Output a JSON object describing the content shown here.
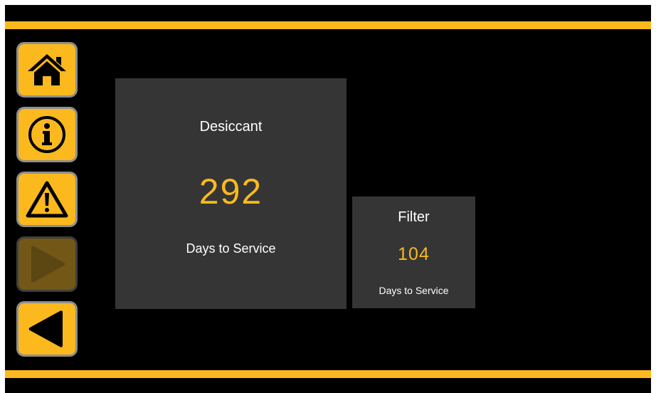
{
  "nav": {
    "buttons": [
      {
        "icon": "home-icon",
        "enabled": true
      },
      {
        "icon": "info-icon",
        "enabled": true
      },
      {
        "icon": "warning-icon",
        "enabled": true
      },
      {
        "icon": "play-right-icon",
        "enabled": false
      },
      {
        "icon": "back-left-icon",
        "enabled": true
      }
    ]
  },
  "tiles": {
    "desiccant": {
      "title": "Desiccant",
      "value": "292",
      "caption": "Days to Service"
    },
    "filter": {
      "title": "Filter",
      "value": "104",
      "caption": "Days to Service"
    }
  },
  "colors": {
    "accent": "#fbb91d",
    "accent_disabled": "#735717",
    "tile_bg": "#353535",
    "background": "#000000"
  }
}
